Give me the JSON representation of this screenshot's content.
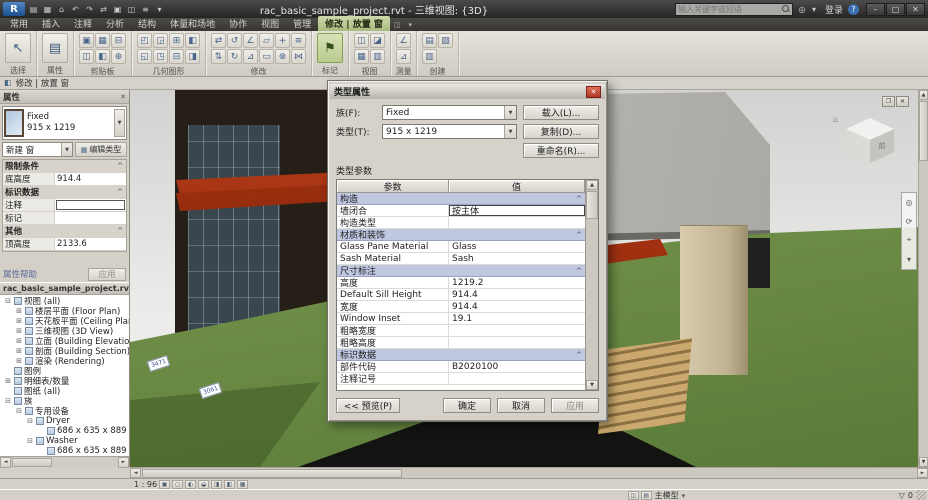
{
  "colors": {
    "context-green": "#cdd9ab",
    "section-blue": "#bfc7e1",
    "grass": "#8ba75e",
    "canopy-red": "#b23a16",
    "roof-gray": "#c6c5c0",
    "wall-tan": "#d9ccad",
    "dialog-gray": "#d6d2c9"
  },
  "titlebar": {
    "title": "rac_basic_sample_project.rvt - 三维视图: {3D}",
    "search_placeholder": "输入关键字或短语",
    "sign_in": "登录",
    "help": "?",
    "qat_icons": [
      "▤",
      "▦",
      "⌂",
      "↶",
      "↷",
      "⇄",
      "▣",
      "◫",
      "≡",
      "▾"
    ],
    "right_icons": [
      "◎",
      "▾"
    ],
    "window_buttons": [
      "–",
      "□",
      "✕"
    ]
  },
  "ribbon": {
    "tabs": [
      "常用",
      "插入",
      "注释",
      "分析",
      "结构",
      "体量和场地",
      "协作",
      "视图",
      "管理"
    ],
    "active_tab": "修改 | 放置 窗",
    "tab_extras": [
      "◫",
      "▾"
    ],
    "panels": [
      {
        "label": "选择",
        "big": [
          "↖"
        ],
        "icons": []
      },
      {
        "label": "属性",
        "big": [
          "▤"
        ],
        "icons": []
      },
      {
        "label": "剪贴板",
        "big": [],
        "icons": [
          "▣",
          "◫",
          "▦",
          "◧",
          "⊟",
          "⊕"
        ]
      },
      {
        "label": "几何图形",
        "big": [],
        "icons": [
          "◰",
          "◱",
          "◲",
          "◳",
          "⊞",
          "⊟",
          "◧",
          "◨"
        ]
      },
      {
        "label": "修改",
        "big": [],
        "icons": [
          "⇄",
          "⇅",
          "↺",
          "↻",
          "∠",
          "⊿",
          "▱",
          "▭",
          "+",
          "⊗",
          "≡",
          "⋈"
        ]
      },
      {
        "label": "标记",
        "big": [
          "⚑"
        ],
        "icons": []
      },
      {
        "label": "视图",
        "big": [],
        "icons": [
          "◫",
          "▦",
          "◪",
          "▥"
        ]
      },
      {
        "label": "测量",
        "big": [],
        "icons": [
          "∠",
          "⊿"
        ]
      },
      {
        "label": "创建",
        "big": [],
        "icons": [
          "▤",
          "▥",
          "▧"
        ]
      }
    ]
  },
  "optionsbar": {
    "label": "修改 | 放置 窗"
  },
  "properties": {
    "panel_title": "属性",
    "type_name": "Fixed",
    "type_size": "915 x 1219",
    "selector_label": "新建 窗",
    "edit_type_label": "编辑类型",
    "rows": [
      {
        "type": "section",
        "label": "限制条件",
        "value": ""
      },
      {
        "type": "row",
        "label": "底高度",
        "value": "914.4"
      },
      {
        "type": "section",
        "label": "标识数据",
        "value": ""
      },
      {
        "type": "input",
        "label": "注释",
        "value": ""
      },
      {
        "type": "row",
        "label": "标记",
        "value": ""
      },
      {
        "type": "section",
        "label": "其他",
        "value": ""
      },
      {
        "type": "row",
        "label": "顶高度",
        "value": "2133.6"
      }
    ],
    "help_label": "属性帮助",
    "apply_label": "应用"
  },
  "browser": {
    "title": "rac_basic_sample_project.rvt - ...",
    "items": [
      {
        "level": 0,
        "exp": "⊟",
        "label": "视图 (all)"
      },
      {
        "level": 1,
        "exp": "⊞",
        "label": "楼层平面 (Floor Plan)"
      },
      {
        "level": 1,
        "exp": "⊞",
        "label": "天花板平面 (Ceiling Plan)"
      },
      {
        "level": 1,
        "exp": "⊞",
        "label": "三维视图 (3D View)"
      },
      {
        "level": 1,
        "exp": "⊞",
        "label": "立面 (Building Elevation)"
      },
      {
        "level": 1,
        "exp": "⊞",
        "label": "剖面 (Building Section)"
      },
      {
        "level": 1,
        "exp": "⊞",
        "label": "渲染 (Rendering)"
      },
      {
        "level": 0,
        "exp": "",
        "label": "图例"
      },
      {
        "level": 0,
        "exp": "⊞",
        "label": "明细表/数量"
      },
      {
        "level": 0,
        "exp": "",
        "label": "图纸 (all)"
      },
      {
        "level": 0,
        "exp": "⊟",
        "label": "族"
      },
      {
        "level": 1,
        "exp": "⊟",
        "label": "专用设备"
      },
      {
        "level": 2,
        "exp": "⊟",
        "label": "Dryer"
      },
      {
        "level": 3,
        "exp": "",
        "label": "686 x 635 x 889"
      },
      {
        "level": 2,
        "exp": "⊟",
        "label": "Washer"
      },
      {
        "level": 3,
        "exp": "",
        "label": "686 x 635 x 889"
      }
    ]
  },
  "dialog": {
    "title": "类型属性",
    "family": {
      "label": "族(F):",
      "value": "Fixed",
      "button": "载入(L)..."
    },
    "type": {
      "label": "类型(T):",
      "value": "915 x 1219",
      "button": "复制(D)..."
    },
    "rename_button": "重命名(R)...",
    "params_label": "类型参数",
    "table": {
      "col_param": "参数",
      "col_value": "值",
      "rows": [
        {
          "type": "section",
          "label": "构造",
          "value": ""
        },
        {
          "type": "input",
          "label": "墙闭合",
          "value": "按主体"
        },
        {
          "type": "row",
          "label": "构造类型",
          "value": ""
        },
        {
          "type": "section",
          "label": "材质和装饰",
          "value": ""
        },
        {
          "type": "row",
          "label": "Glass Pane Material",
          "value": "Glass"
        },
        {
          "type": "row",
          "label": "Sash Material",
          "value": "Sash"
        },
        {
          "type": "section",
          "label": "尺寸标注",
          "value": ""
        },
        {
          "type": "row",
          "label": "高度",
          "value": "1219.2"
        },
        {
          "type": "row",
          "label": "Default Sill Height",
          "value": "914.4"
        },
        {
          "type": "row",
          "label": "宽度",
          "value": "914.4"
        },
        {
          "type": "row",
          "label": "Window Inset",
          "value": "19.1"
        },
        {
          "type": "row",
          "label": "粗略宽度",
          "value": ""
        },
        {
          "type": "row",
          "label": "粗略高度",
          "value": ""
        },
        {
          "type": "section",
          "label": "标识数据",
          "value": ""
        },
        {
          "type": "row",
          "label": "部件代码",
          "value": "B2020100"
        },
        {
          "type": "row",
          "label": "注释记号",
          "value": ""
        }
      ]
    },
    "preview_button": "<< 预览(P)",
    "ok_button": "确定",
    "cancel_button": "取消",
    "apply_button": "应用"
  },
  "scene": {
    "tags": [
      "3471",
      "3061"
    ],
    "viewcube_front": "前",
    "navbar_icons": [
      "◎",
      "⟳",
      "⌖",
      "▾"
    ]
  },
  "viewbar": {
    "scale": "1 : 96",
    "icons": [
      "▣",
      "◻",
      "◐",
      "◒",
      "◨",
      "◧",
      "▦"
    ]
  },
  "statusbar": {
    "mid_icons": [
      "◫",
      "▤"
    ],
    "design_option": "主模型",
    "filter_count": "0"
  }
}
